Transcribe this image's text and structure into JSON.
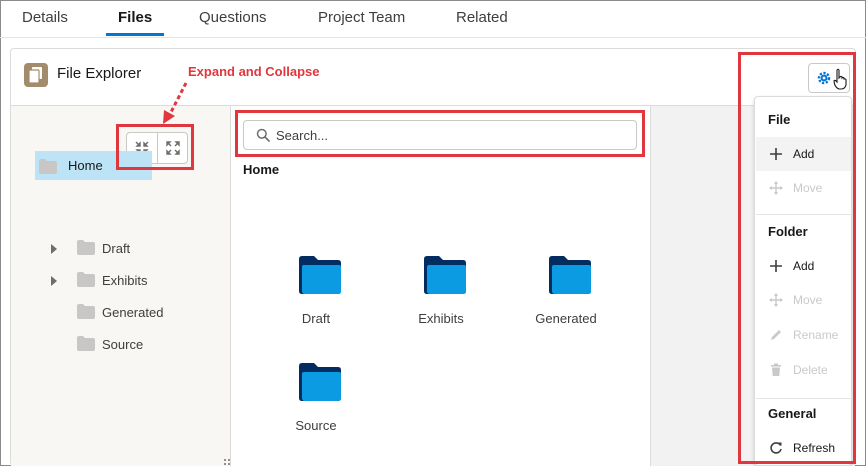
{
  "tabs": [
    {
      "label": "Details",
      "active": false
    },
    {
      "label": "Files",
      "active": true
    },
    {
      "label": "Questions",
      "active": false
    },
    {
      "label": "Project Team",
      "active": false
    },
    {
      "label": "Related",
      "active": false
    }
  ],
  "card": {
    "title": "File Explorer",
    "icon": "file-explorer-icon",
    "settings_icon": "gear-icon"
  },
  "tree": {
    "root": {
      "label": "Home",
      "selected": true
    },
    "children": [
      {
        "label": "Draft",
        "expandable": true
      },
      {
        "label": "Exhibits",
        "expandable": true
      },
      {
        "label": "Generated",
        "expandable": false
      },
      {
        "label": "Source",
        "expandable": false
      }
    ],
    "collapse_icon": "collapse-all-icon",
    "expand_icon": "expand-all-icon"
  },
  "main": {
    "search_placeholder": "Search...",
    "path": "Home",
    "items": [
      {
        "label": "Draft"
      },
      {
        "label": "Exhibits"
      },
      {
        "label": "Generated"
      },
      {
        "label": "Source"
      }
    ]
  },
  "menu": {
    "sections": [
      {
        "header": "File",
        "items": [
          {
            "label": "Add",
            "icon": "add-icon",
            "enabled": true
          },
          {
            "label": "Move",
            "icon": "move-icon",
            "enabled": false
          }
        ]
      },
      {
        "header": "Folder",
        "items": [
          {
            "label": "Add",
            "icon": "add-icon",
            "enabled": true
          },
          {
            "label": "Move",
            "icon": "move-icon",
            "enabled": false
          },
          {
            "label": "Rename",
            "icon": "rename-icon",
            "enabled": false
          },
          {
            "label": "Delete",
            "icon": "delete-icon",
            "enabled": false
          }
        ]
      },
      {
        "header": "General",
        "items": [
          {
            "label": "Refresh",
            "icon": "refresh-icon",
            "enabled": true
          }
        ]
      }
    ]
  },
  "annotation": {
    "label": "Expand and Collapse",
    "color": "#e0363d"
  },
  "colors": {
    "brand_blue": "#0176d3",
    "folder_dark": "#032d60",
    "folder_light": "#0b9be2",
    "selected_bg": "#bde3f7",
    "tree_folder": "#c9c7c5"
  }
}
